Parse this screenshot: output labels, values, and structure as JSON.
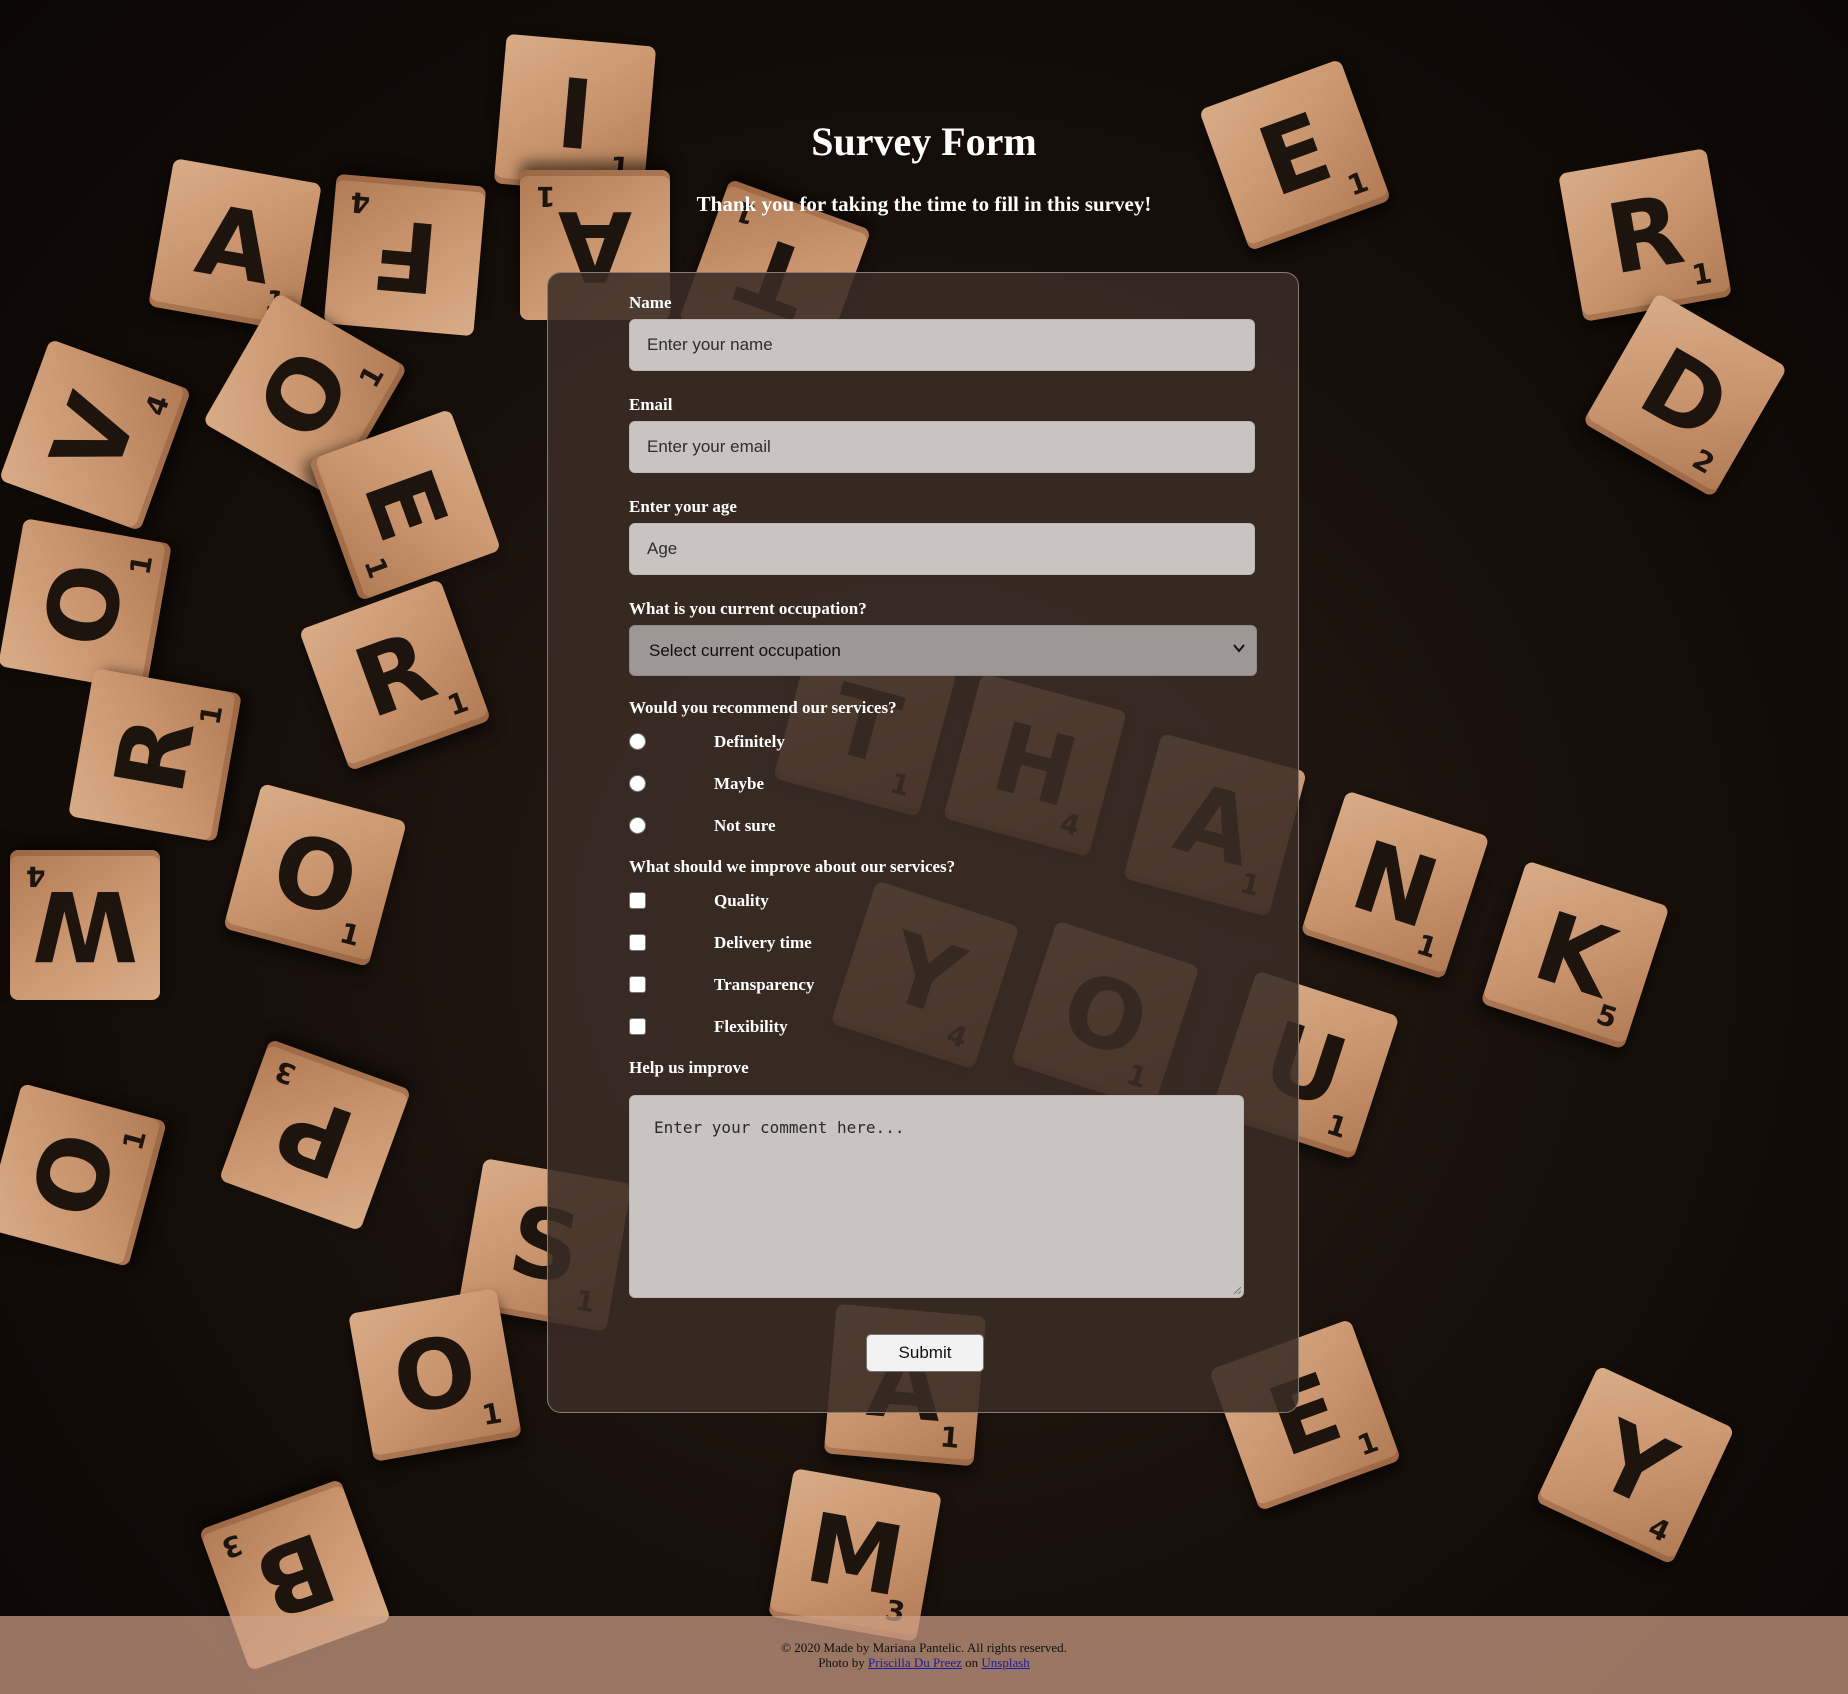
{
  "header": {
    "title": "Survey Form",
    "subtitle": "Thank you for taking the time to fill in this survey!"
  },
  "form": {
    "name": {
      "label": "Name",
      "placeholder": "Enter your name"
    },
    "email": {
      "label": "Email",
      "placeholder": "Enter your email"
    },
    "age": {
      "label": "Enter your age",
      "placeholder": "Age"
    },
    "occupation": {
      "label": "What is you current occupation?",
      "selected": "Select current occupation"
    },
    "recommend": {
      "label": "Would you recommend our services?",
      "options": [
        "Definitely",
        "Maybe",
        "Not sure"
      ]
    },
    "improve": {
      "label": "What should we improve about our services?",
      "options": [
        "Quality",
        "Delivery time",
        "Transparency",
        "Flexibility"
      ]
    },
    "comment": {
      "label": "Help us improve",
      "placeholder": "Enter your comment here..."
    },
    "submit_label": "Submit"
  },
  "footer": {
    "copyright": "© 2020 Made by Mariana Pantelic. All rights reserved.",
    "photo_prefix": "Photo by",
    "photographer": "Priscilla Du Preez",
    "on_text": "on",
    "site": "Unsplash"
  },
  "background": {
    "tile_letters": [
      "I",
      "A",
      "F",
      "A",
      "T",
      "E",
      "R",
      "D",
      "V",
      "O",
      "E",
      "O",
      "R",
      "R",
      "T",
      "H",
      "A",
      "N",
      "K",
      "W",
      "O",
      "Y",
      "O",
      "U",
      "P",
      "S",
      "O",
      "A",
      "E",
      "Y",
      "B",
      "M",
      "O"
    ]
  },
  "colors": {
    "card_background": "#3a2c25",
    "field_background": "#c9c4c1",
    "footer_background": "#cda087",
    "text_light": "#ffffff"
  }
}
